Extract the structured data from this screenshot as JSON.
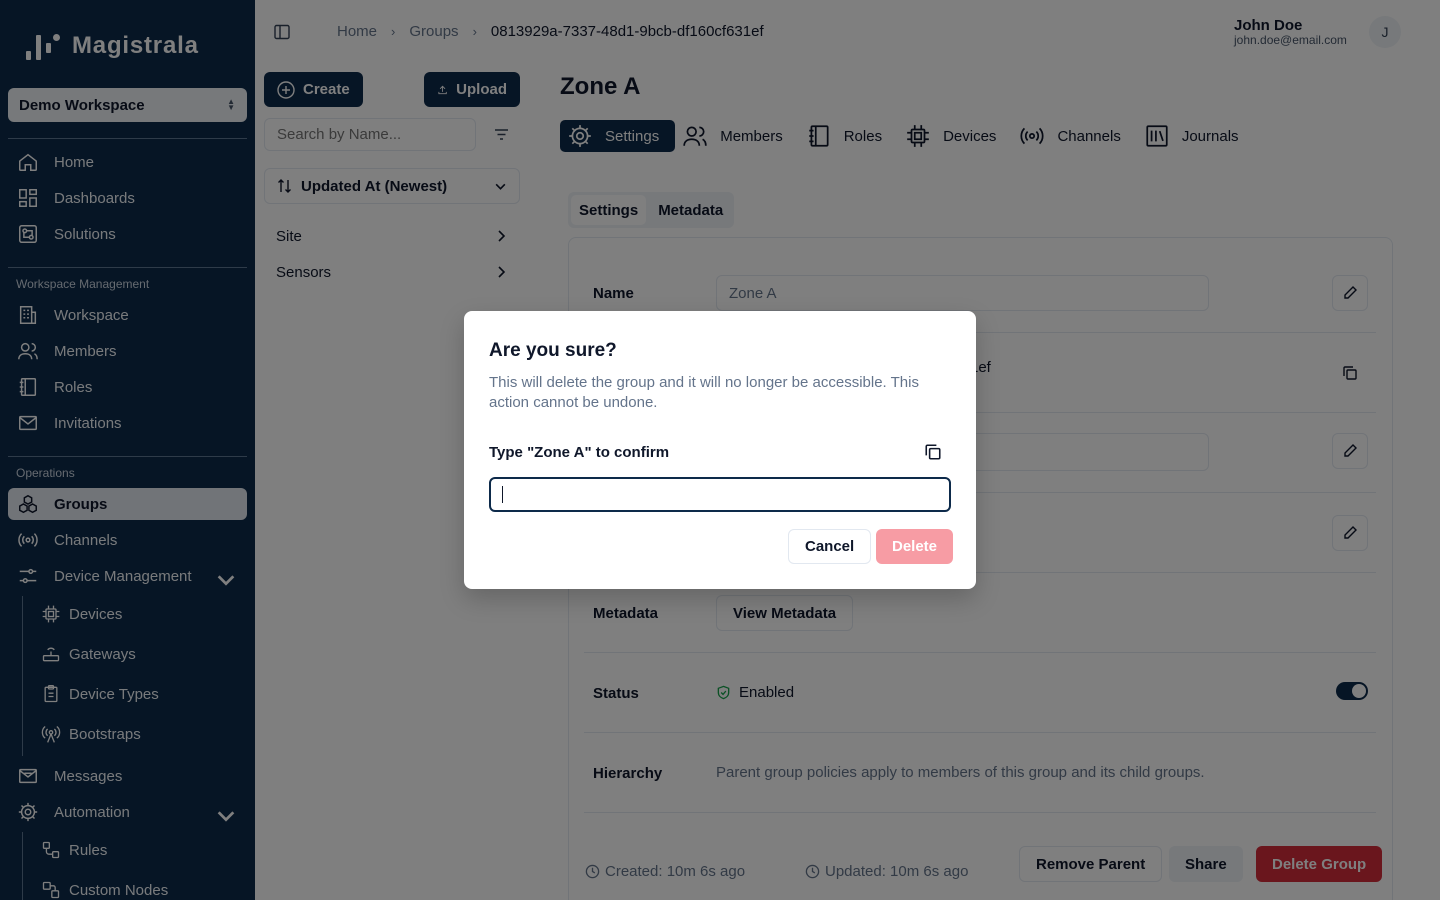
{
  "app": {
    "name": "Magistrala"
  },
  "workspace": {
    "name": "Demo Workspace"
  },
  "sidebar": {
    "primary": [
      "Home",
      "Dashboards",
      "Solutions"
    ],
    "workspace_section": "Workspace Management",
    "workspace_items": [
      "Workspace",
      "Members",
      "Roles",
      "Invitations"
    ],
    "operations_section": "Operations",
    "operations_items": [
      "Groups",
      "Channels",
      "Device Management"
    ],
    "device_items": [
      "Devices",
      "Gateways",
      "Device Types",
      "Bootstraps"
    ],
    "more_items": [
      "Messages",
      "Automation"
    ],
    "automation_items": [
      "Rules",
      "Custom Nodes"
    ]
  },
  "breadcrumb": {
    "home": "Home",
    "groups": "Groups",
    "current": "0813929a-7337-48d1-9bcb-df160cf631ef"
  },
  "user": {
    "name": "John Doe",
    "email": "john.doe@email.com",
    "initial": "J"
  },
  "list_panel": {
    "create_label": "Create",
    "upload_label": "Upload",
    "search_placeholder": "Search by Name...",
    "sort_label": "Updated At (Newest)",
    "items": [
      "Site",
      "Sensors"
    ]
  },
  "group": {
    "title": "Zone A",
    "tabs": [
      "Settings",
      "Members",
      "Roles",
      "Devices",
      "Channels",
      "Journals"
    ],
    "subtabs": [
      "Settings",
      "Metadata"
    ],
    "fields": {
      "name_label": "Name",
      "name_value": "Zone A",
      "id_tail": "1ef",
      "metadata_label": "Metadata",
      "metadata_button": "View Metadata",
      "status_label": "Status",
      "status_value": "Enabled",
      "hierarchy_label": "Hierarchy",
      "hierarchy_text": "Parent group policies apply to members of this group and its child groups."
    },
    "footer": {
      "created": "Created: 10m 6s ago",
      "updated": "Updated: 10m 6s ago",
      "remove_parent": "Remove Parent",
      "share": "Share",
      "delete_group": "Delete Group"
    }
  },
  "dialog": {
    "title": "Are you sure?",
    "description": "This will delete the group and it will no longer be accessible. This action cannot be undone.",
    "confirm_label": "Type \"Zone A\" to confirm",
    "input_value": "",
    "cancel": "Cancel",
    "delete": "Delete"
  },
  "colors": {
    "brand": "#0d2a4a",
    "danger": "#d42d3a",
    "danger_disabled": "#f79ca4",
    "success": "#16a34a"
  }
}
